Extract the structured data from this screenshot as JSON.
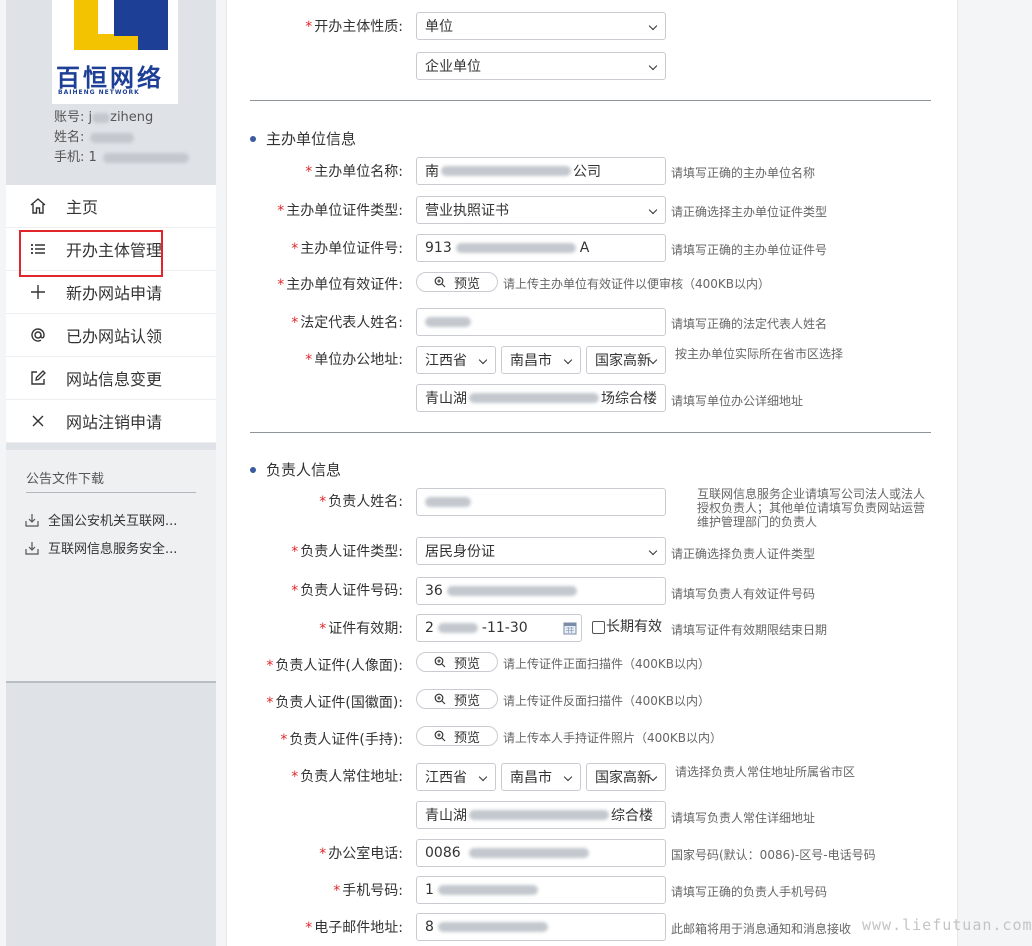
{
  "sidebar": {
    "logo_cn": "百恒网络",
    "logo_en": "BAIHENG NETWORK",
    "user": {
      "account_label": "账号: j",
      "account_tail": "ziheng",
      "name_label": "姓名:",
      "phone_label": "手机: 1"
    },
    "nav": [
      {
        "label": "主页",
        "icon": "home-icon"
      },
      {
        "label": "开办主体管理",
        "icon": "list-icon"
      },
      {
        "label": "新办网站申请",
        "icon": "plus-icon"
      },
      {
        "label": "已办网站认领",
        "icon": "at-icon"
      },
      {
        "label": "网站信息变更",
        "icon": "edit-icon"
      },
      {
        "label": "网站注销申请",
        "icon": "close-icon"
      }
    ],
    "downloads": {
      "title": "公告文件下载",
      "items": [
        "全国公安机关互联网...",
        "互联网信息服务安全..."
      ]
    }
  },
  "form": {
    "nature": {
      "label": "开办主体性质:",
      "value": "单位",
      "sub_value": "企业单位"
    },
    "org_section": "主办单位信息",
    "org_name": {
      "label": "主办单位名称:",
      "value_start": "南",
      "value_end": "公司",
      "hint": "请填写正确的主办单位名称"
    },
    "org_cert_type": {
      "label": "主办单位证件类型:",
      "value": "营业执照证书",
      "hint": "请正确选择主办单位证件类型"
    },
    "org_cert_no": {
      "label": "主办单位证件号:",
      "value_start": "913",
      "value_end": "A",
      "hint": "请填写正确的主办单位证件号"
    },
    "org_cert_file": {
      "label": "主办单位有效证件:",
      "button": "预览",
      "hint": "请上传主办单位有效证件以便审核（400KB以内）"
    },
    "legal_rep": {
      "label": "法定代表人姓名:",
      "hint": "请填写正确的法定代表人姓名"
    },
    "org_address": {
      "label": "单位办公地址:",
      "province": "江西省",
      "city": "南昌市",
      "district": "国家高新",
      "hint": "按主办单位实际所在省市区选择",
      "detail_start": "青山湖",
      "detail_end": "场综合楼",
      "detail_hint": "请填写单位办公详细地址"
    },
    "person_section": "负责人信息",
    "person_name": {
      "label": "负责人姓名:",
      "hint_lines": [
        "互联网信息服务企业请填写公司法人或法人",
        "授权负责人；其他单位请填写负责网站运营",
        "维护管理部门的负责人"
      ]
    },
    "person_cert_type": {
      "label": "负责人证件类型:",
      "value": "居民身份证",
      "hint": "请正确选择负责人证件类型"
    },
    "person_cert_no": {
      "label": "负责人证件号码:",
      "value_start": "36",
      "hint": "请填写负责人有效证件号码"
    },
    "cert_valid": {
      "label": "证件有效期:",
      "value_start": "2",
      "value_end": "-11-30",
      "long_term": "长期有效",
      "hint": "请填写证件有效期限结束日期"
    },
    "cert_front": {
      "label": "负责人证件(人像面):",
      "button": "预览",
      "hint": "请上传证件正面扫描件（400KB以内）"
    },
    "cert_back": {
      "label": "负责人证件(国徽面):",
      "button": "预览",
      "hint": "请上传证件反面扫描件（400KB以内）"
    },
    "cert_hand": {
      "label": "负责人证件(手持):",
      "button": "预览",
      "hint": "请上传本人手持证件照片（400KB以内）"
    },
    "person_address": {
      "label": "负责人常住地址:",
      "province": "江西省",
      "city": "南昌市",
      "district": "国家高新",
      "hint": "请选择负责人常住地址所属省市区",
      "detail_start": "青山湖",
      "detail_end": "综合楼",
      "detail_hint": "请填写负责人常住详细地址"
    },
    "office_phone": {
      "label": "办公室电话:",
      "value_start": "0086",
      "hint": "国家号码(默认：0086)-区号-电话号码"
    },
    "mobile": {
      "label": "手机号码:",
      "value_start": "1",
      "hint": "请填写正确的负责人手机号码"
    },
    "email": {
      "label": "电子邮件地址:",
      "value_start": "8",
      "hint": "此邮箱将用于消息通知和消息接收"
    }
  },
  "watermark": "www.liefutuan.com",
  "colors": {
    "required_star": "#e0262b",
    "highlight_box": "#e0262b",
    "section_dot": "#3b5ba0",
    "logo_blue": "#1d3f95",
    "logo_yellow": "#f3c200"
  }
}
